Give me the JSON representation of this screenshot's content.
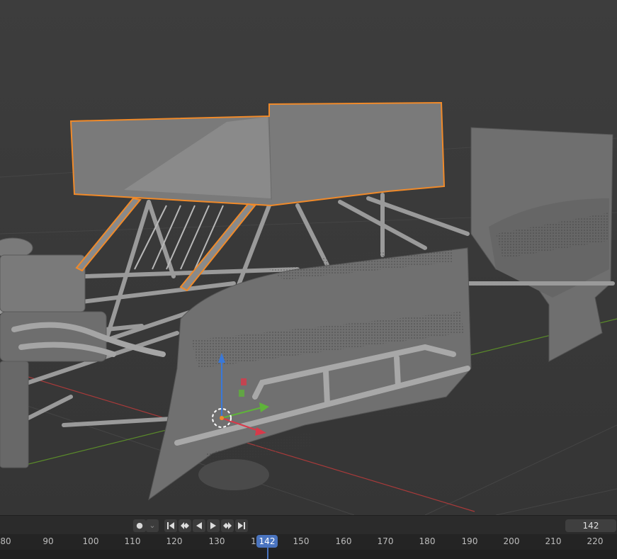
{
  "app": "Blender",
  "viewport": {
    "description_name": "3d-viewport",
    "selection_color": "#f08a2a"
  },
  "timeline": {
    "current_frame": "142",
    "frame_field_value": "142",
    "ruler_labels": [
      "80",
      "90",
      "100",
      "110",
      "120",
      "130",
      "1",
      "150",
      "160",
      "170",
      "180",
      "190",
      "200",
      "210",
      "220"
    ],
    "keyframe_dot": "●",
    "keyframe_dropdown": "⌄",
    "icons": {
      "jump_start": "jump-to-start-icon",
      "prev_key": "jump-to-previous-keyframe-icon",
      "play_reverse": "play-reverse-icon",
      "play": "play-icon",
      "next_key": "jump-to-next-keyframe-icon",
      "jump_end": "jump-to-end-icon"
    },
    "accent": "#4a74bf"
  }
}
